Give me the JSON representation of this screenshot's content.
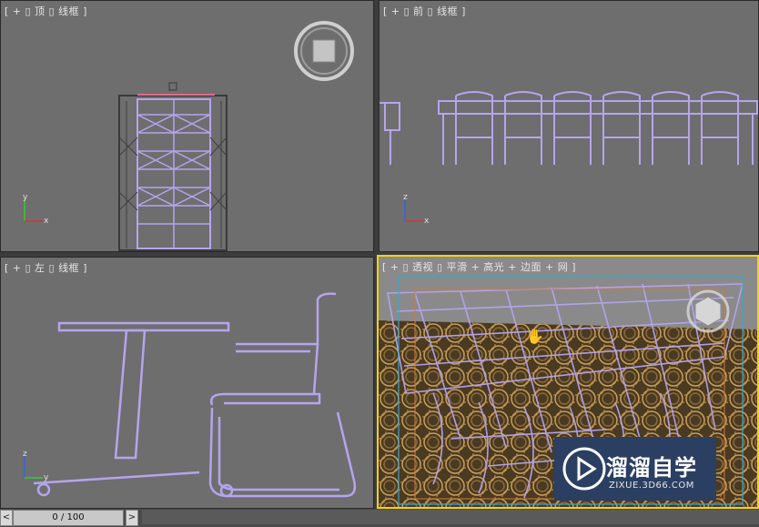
{
  "viewports": {
    "top": {
      "label": "[ + ▯ 顶 ▯ 线框 ]"
    },
    "front": {
      "label": "[ + ▯ 前 ▯ 线框 ]"
    },
    "left": {
      "label": "[ + ▯ 左 ▯ 线框 ]"
    },
    "perspective": {
      "label": "[ + ▯ 透视 ▯ 平滑 + 高光 + 边面 + 网 ]"
    }
  },
  "axes": {
    "x": "x",
    "y": "y",
    "z": "z"
  },
  "timeslider": {
    "prev": "<",
    "next": ">",
    "frame": "0 / 100"
  },
  "brand": {
    "name": "溜溜自学",
    "url": "ZIXUE.3D66.COM"
  },
  "colors": {
    "wire": "#b6a4ee",
    "active_border": "#f2d21c",
    "viewport_bg": "#6e6e6e"
  }
}
